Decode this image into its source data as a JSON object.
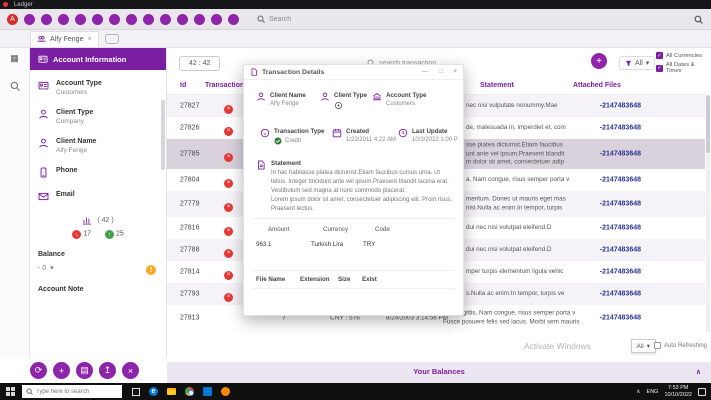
{
  "titlebar": {
    "app": "Ledger"
  },
  "toolbar": {
    "avatar": "A",
    "search_placeholder": "Search"
  },
  "tabbar": {
    "tab": "Alfy Fenge"
  },
  "controls": {
    "range": "42 : 42",
    "search_placeholder": "search transaction",
    "filter": "All",
    "all_currencies": "All Currencies",
    "all_dates": "All Dates & Times"
  },
  "sidebar": {
    "title": "Account Information",
    "items": [
      {
        "label": "Account Type",
        "value": "Customers"
      },
      {
        "label": "Client Type",
        "value": "Company"
      },
      {
        "label": "Client Name",
        "value": "Alfy Fenge"
      },
      {
        "label": "Phone",
        "value": ""
      },
      {
        "label": "Email",
        "value": ""
      }
    ],
    "stats": {
      "total": "( 42 )",
      "down_count": "17",
      "up_count": "25"
    },
    "balance_label": "Balance",
    "balance_value": "- 0",
    "note_label": "Account Note"
  },
  "table": {
    "col_id": "Id",
    "col_type": "Transaction Typ...",
    "col_statement": "Statement",
    "col_attached": "Attached Files",
    "rows": [
      {
        "id": "27827",
        "statement": "nec nisi vulputate nonummy.Mae",
        "attached": "-2147483648"
      },
      {
        "id": "27826",
        "statement": "de, malesuada in, imperdiet et, com",
        "attached": "-2147483648"
      },
      {
        "id": "27785",
        "statement": "sse platea dictumst.Etiam faucibus\nunt ante vel ipsum.Praesent blandit\nm dolor sit amet, consectetuer adip",
        "attached": "-2147483648"
      },
      {
        "id": "27804",
        "statement": "a. Nam congue, risus semper porta v",
        "attached": "-2147483648"
      },
      {
        "id": "27779",
        "statement": "mentum. Donec ut mauris eget mas\nnisl.Nulla ac enim.In tempor, turpis",
        "attached": "-2147483648"
      },
      {
        "id": "27816",
        "statement": "dui nec nisi volutpat eleifend.D",
        "attached": "-2147483648"
      },
      {
        "id": "27788",
        "statement": "dui nec nisi volutpat eleifend.D",
        "attached": "-2147483648"
      },
      {
        "id": "27814",
        "statement": "mper turpis elementum ligula vehic",
        "attached": "-2147483648"
      },
      {
        "id": "27793",
        "statement": "s.Nulla ac enim.In tempor, turpis ve",
        "attached": "-2147483648"
      },
      {
        "id": "27813",
        "type_value": "7",
        "currency": "CNY : 576",
        "created": "8/24/2003 3:14:56 PM",
        "statement": "Sed sagittis. Nam congue, risus semper porta v\nFusce posuere felis sed lacus. Morbi sem mauris",
        "attached": "-2147483648"
      }
    ]
  },
  "modal": {
    "title": "Transaction Details",
    "client_name_label": "Client Name",
    "client_name": "Alfy Fenge",
    "client_type_label": "Client Type",
    "account_type_label": "Account Type",
    "account_type": "Customers",
    "transaction_type_label": "Transaction Type",
    "transaction_type": "Credit",
    "created_label": "Created",
    "created": "1/22/2011 4:22 AM",
    "last_update_label": "Last Update",
    "last_update": "10/3/2022 1:00 P",
    "statement_label": "Statement",
    "statement": "In hac habitasse platea dictumst.Etiam faucibus cursus urna. Ut tellus. Integer tincidunt ante vel ipsum.Praesent blandit lacinia erat. Vestibulum sed magna at nunc commodo placerat.\nLorem ipsum dolor sit amet, consectetuer adipiscing elit. Proin risus. Praesent lectus.",
    "amount_label": "Amount",
    "amount": "963.1",
    "currency_label": "Currency",
    "currency": "Turkish Lira",
    "code_label": "Code",
    "code": "TRY",
    "file_cols": {
      "name": "File Name",
      "ext": "Extension",
      "size": "Size",
      "exist": "Exist"
    }
  },
  "footer": {
    "balances": "Your Balances",
    "page_size": "All",
    "auto_refresh": "Auto Refreshing",
    "watermark": "Activate Windows"
  },
  "taskbar": {
    "search_placeholder": "Type here to search",
    "lang": "ENG",
    "time": "7:53 PM",
    "date": "10/10/2022"
  },
  "icons": {
    "debit": "×",
    "close": "×",
    "minimize": "—",
    "maximize": "□",
    "caret": "▾",
    "chevron_up": "∧",
    "check": "✓",
    "down_arrow": "↓",
    "up_arrow": "↑",
    "refresh": "⟳",
    "plus": "+",
    "archive": "▤",
    "export": "↥",
    "warning": "!",
    "grid": "▦",
    "edge_letter": "e"
  }
}
